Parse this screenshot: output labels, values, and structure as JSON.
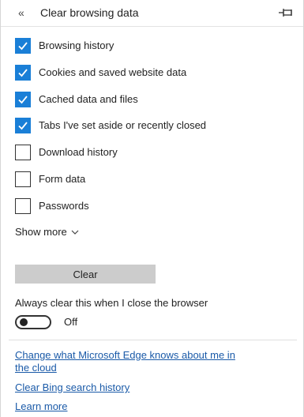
{
  "header": {
    "back_glyph": "«",
    "title": "Clear browsing data",
    "back_icon": "double-chevron-left-icon",
    "pin_icon": "pin-icon"
  },
  "options": [
    {
      "label": "Browsing history",
      "checked": true
    },
    {
      "label": "Cookies and saved website data",
      "checked": true
    },
    {
      "label": "Cached data and files",
      "checked": true
    },
    {
      "label": "Tabs I've set aside or recently closed",
      "checked": true
    },
    {
      "label": "Download history",
      "checked": false
    },
    {
      "label": "Form data",
      "checked": false
    },
    {
      "label": "Passwords",
      "checked": false
    }
  ],
  "show_more": {
    "label": "Show more",
    "icon": "chevron-down-icon"
  },
  "clear_button": {
    "label": "Clear"
  },
  "always_clear": {
    "label": "Always clear this when I close the browser",
    "state": "Off",
    "on": false
  },
  "links": {
    "edge_knows_line1": "Change what Microsoft Edge knows about me in",
    "edge_knows_line2": "the cloud",
    "bing_history": "Clear Bing search history",
    "learn_more": "Learn more"
  },
  "colors": {
    "accent": "#1a7fd7",
    "link": "#1a5aa8",
    "button_bg": "#cccccc"
  }
}
